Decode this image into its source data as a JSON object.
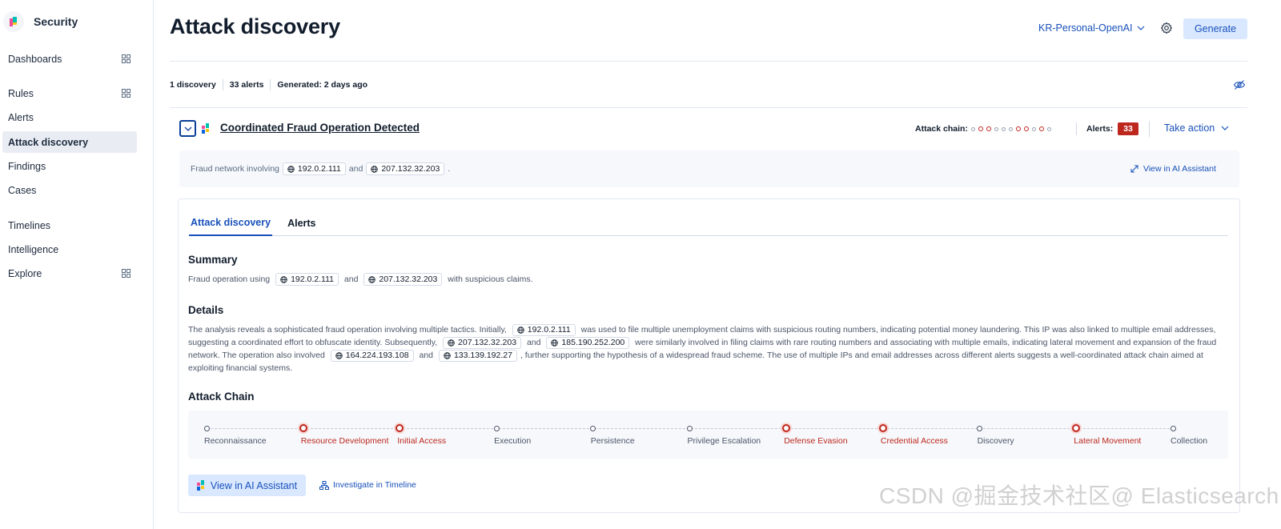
{
  "sidebar": {
    "brand": "Security",
    "items": [
      {
        "label": "Dashboards"
      },
      {
        "label": "Rules"
      },
      {
        "label": "Alerts"
      },
      {
        "label": "Attack discovery"
      },
      {
        "label": "Findings"
      },
      {
        "label": "Cases"
      },
      {
        "label": "Timelines"
      },
      {
        "label": "Intelligence"
      },
      {
        "label": "Explore"
      }
    ]
  },
  "header": {
    "title": "Attack discovery",
    "connector": "KR-Personal-OpenAI",
    "generate_label": "Generate"
  },
  "stats": {
    "discoveries": "1 discovery",
    "alerts": "33 alerts",
    "generated": "Generated: 2 days ago"
  },
  "discovery": {
    "title": "Coordinated Fraud Operation Detected",
    "attack_chain_label": "Attack chain:",
    "alerts_label": "Alerts:",
    "alerts_count": "33",
    "take_action_label": "Take action",
    "summary_prefix": "Fraud network involving",
    "summary_and": "and",
    "summary_end": ".",
    "ip1": "192.0.2.111",
    "ip2": "207.132.32.203",
    "view_ai_label": "View in AI Assistant"
  },
  "tabs": [
    {
      "label": "Attack discovery"
    },
    {
      "label": "Alerts"
    }
  ],
  "summary": {
    "heading": "Summary",
    "t1": "Fraud operation using",
    "ip1": "192.0.2.111",
    "t2": "and",
    "ip2": "207.132.32.203",
    "t3": "with suspicious claims."
  },
  "details": {
    "heading": "Details",
    "t1": "The analysis reveals a sophisticated fraud operation involving multiple tactics. Initially,",
    "ip1": "192.0.2.111",
    "t2": "was used to file multiple unemployment claims with suspicious routing numbers, indicating potential money laundering. This IP was also linked to multiple email addresses, suggesting a coordinated effort to obfuscate identity. Subsequently,",
    "ip2": "207.132.32.203",
    "t3": "and",
    "ip3": "185.190.252.200",
    "t4": "were similarly involved in filing claims with rare routing numbers and associating with multiple emails, indicating lateral movement and expansion of the fraud network. The operation also involved",
    "ip4": "164.224.193.108",
    "t5": "and",
    "ip5": "133.139.192.27",
    "t6": ", further supporting the hypothesis of a widespread fraud scheme. The use of multiple IPs and email addresses across different alerts suggests a well-coordinated attack chain aimed at exploiting financial systems."
  },
  "attack_chain": {
    "heading": "Attack Chain",
    "tactics": [
      {
        "label": "Reconnaissance",
        "detected": false
      },
      {
        "label": "Resource Development",
        "detected": true
      },
      {
        "label": "Initial Access",
        "detected": true
      },
      {
        "label": "Execution",
        "detected": false
      },
      {
        "label": "Persistence",
        "detected": false
      },
      {
        "label": "Privilege Escalation",
        "detected": false
      },
      {
        "label": "Defense Evasion",
        "detected": true
      },
      {
        "label": "Credential Access",
        "detected": true
      },
      {
        "label": "Discovery",
        "detected": false
      },
      {
        "label": "Lateral Movement",
        "detected": true
      },
      {
        "label": "Collection",
        "detected": false
      }
    ]
  },
  "actions": {
    "ai_button": "View in AI Assistant",
    "timeline_link": "Investigate in Timeline"
  },
  "watermark": "CSDN @掘金技术社区@ Elasticsearch中国社区官方博客",
  "colors": {
    "accent": "#1750ba",
    "danger": "#bd271e",
    "primary_button_bg": "#d9e8ff"
  }
}
